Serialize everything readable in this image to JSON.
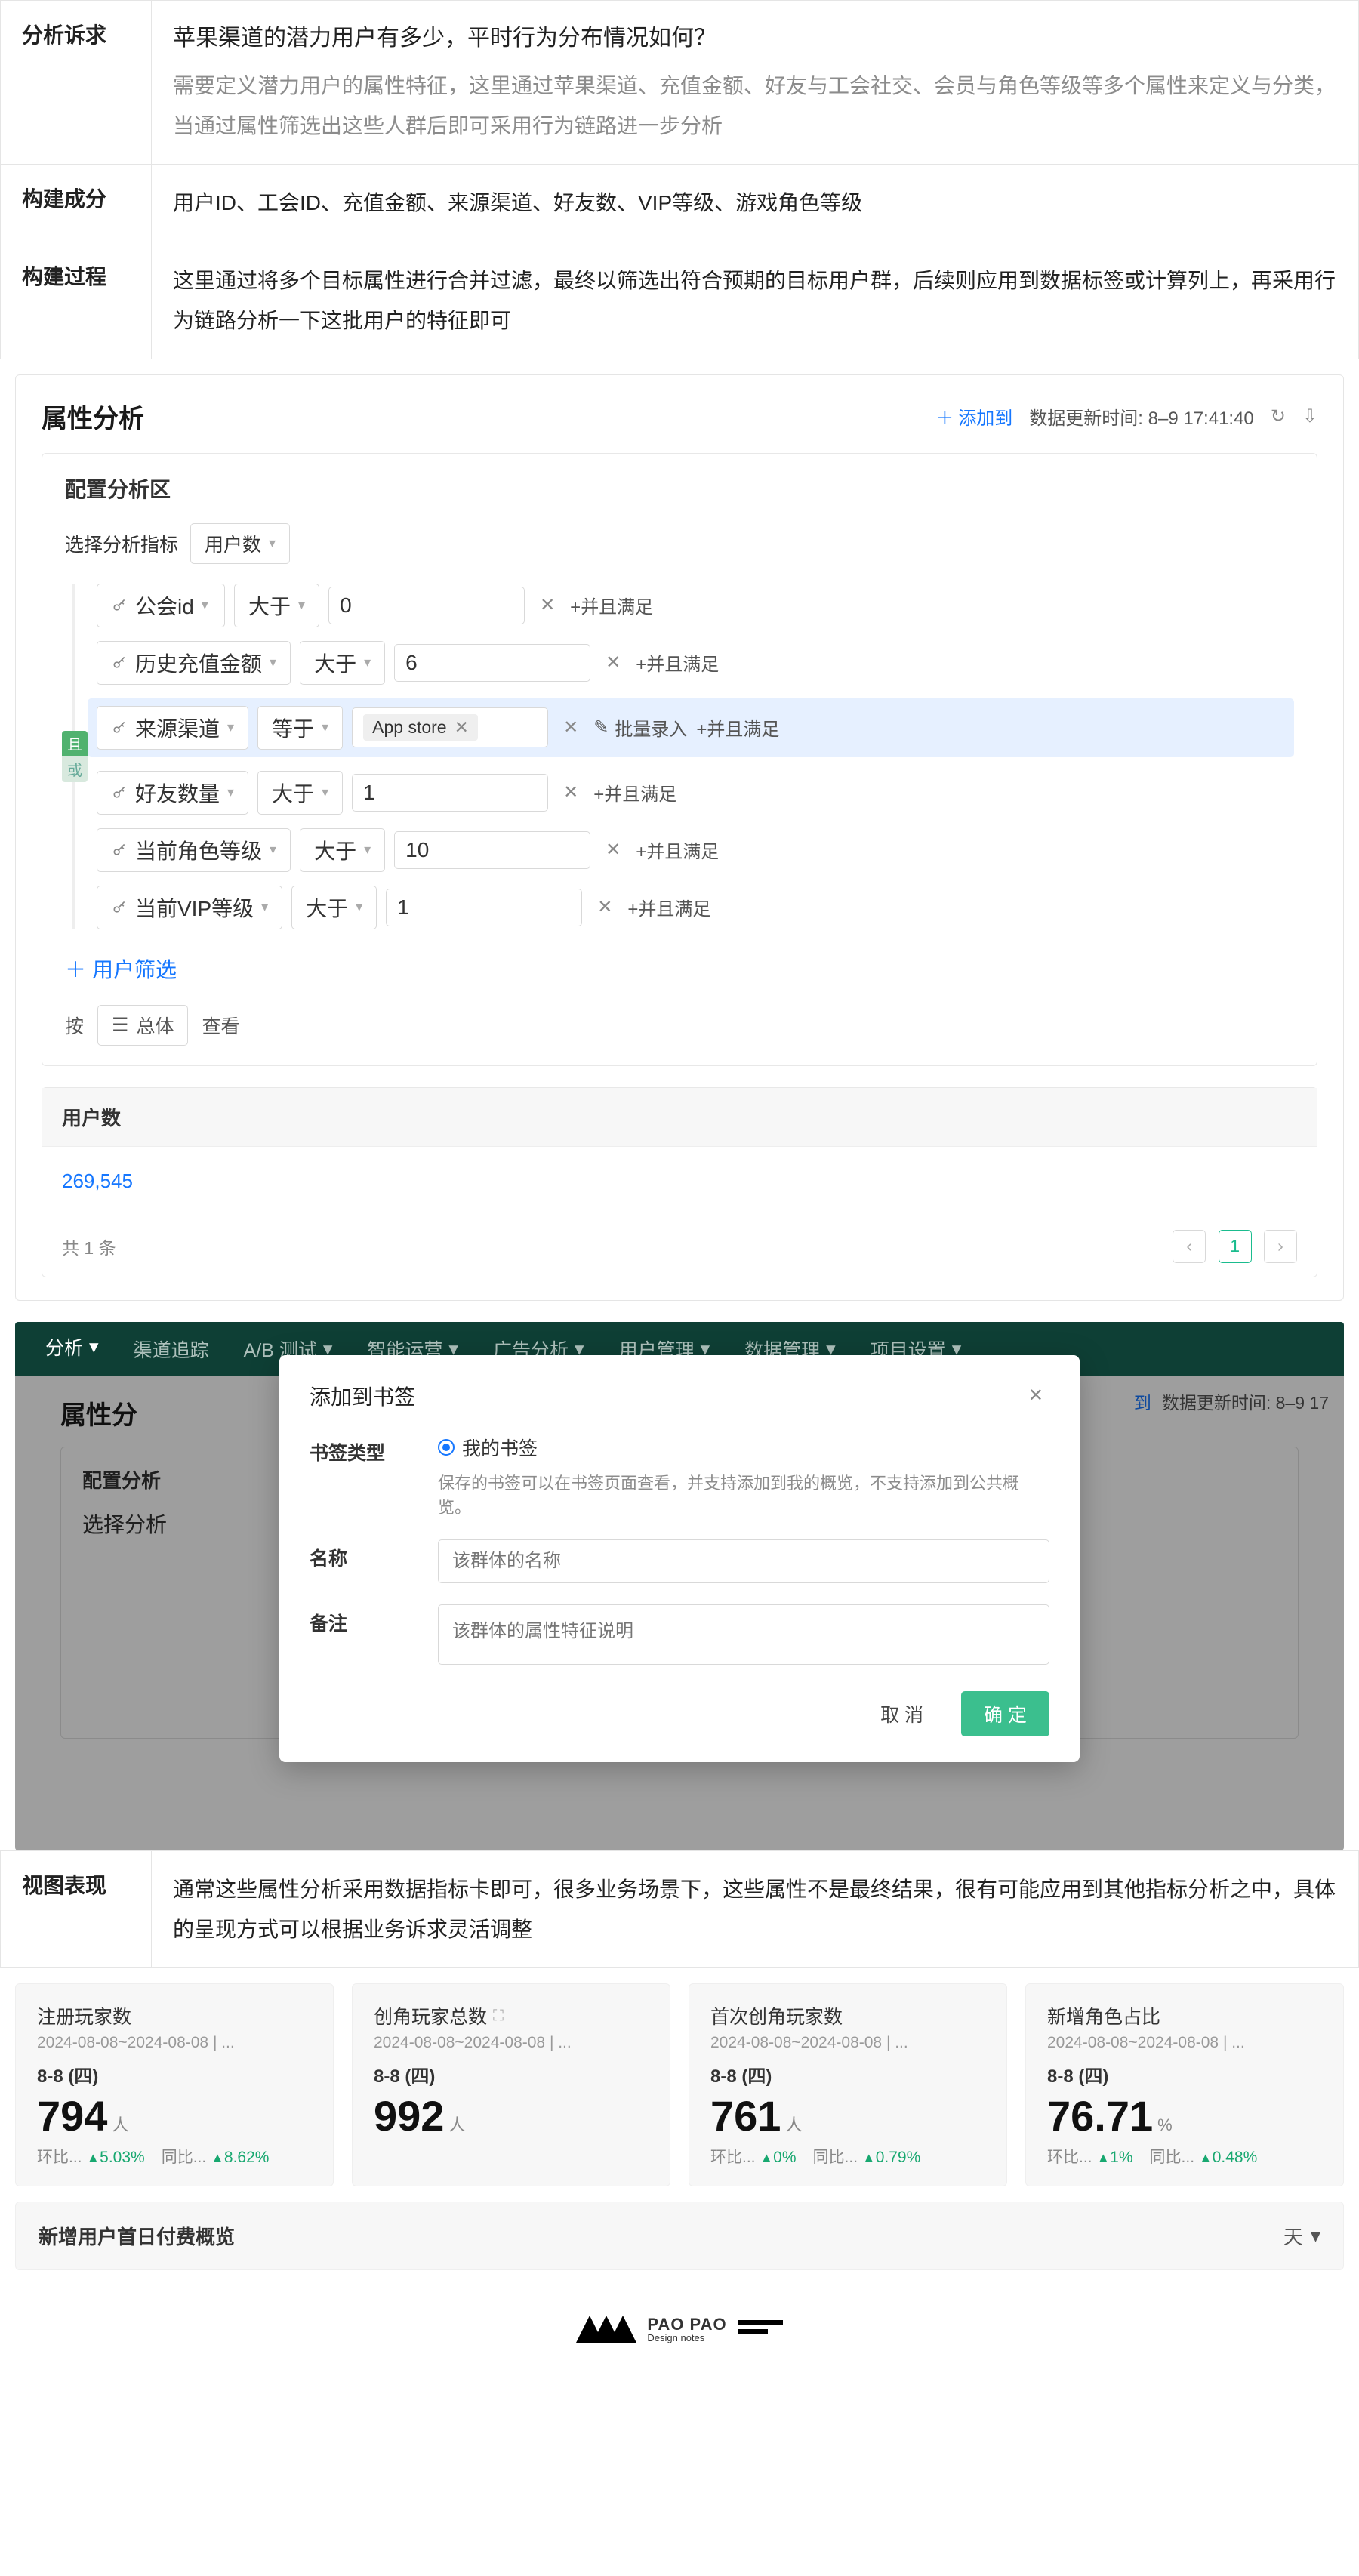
{
  "meta": {
    "rows": [
      {
        "label": "分析诉求",
        "question": "苹果渠道的潜力用户有多少，平时行为分布情况如何？",
        "desc": "需要定义潜力用户的属性特征，这里通过苹果渠道、充值金额、好友与工会社交、会员与角色等级等多个属性来定义与分类，当通过属性筛选出这些人群后即可采用行为链路进一步分析"
      },
      {
        "label": "构建成分",
        "body": "用户ID、工会ID、充值金额、来源渠道、好友数、VIP等级、游戏角色等级"
      },
      {
        "label": "构建过程",
        "body": "这里通过将多个目标属性进行合并过滤，最终以筛选出符合预期的目标用户群，后续则应用到数据标签或计算列上，再采用行为链路分析一下这批用户的特征即可"
      }
    ]
  },
  "panel": {
    "title": "属性分析",
    "add_to": "添加到",
    "update_label": "数据更新时间: 8–9 17:41:40",
    "config_title": "配置分析区",
    "metric_label": "选择分析指标",
    "metric_value": "用户数",
    "and_badge": "且",
    "or_badge": "或",
    "filters": [
      {
        "prop": "公会id",
        "op": "大于",
        "val": "0",
        "add": "+并且满足",
        "type": "text"
      },
      {
        "prop": "历史充值金额",
        "op": "大于",
        "val": "6",
        "add": "+并且满足",
        "type": "text"
      },
      {
        "prop": "来源渠道",
        "op": "等于",
        "val": "App store",
        "add": "+并且满足",
        "type": "chip",
        "hl": true,
        "bulk": "批量录入"
      },
      {
        "prop": "好友数量",
        "op": "大于",
        "val": "1",
        "add": "+并且满足",
        "type": "text"
      },
      {
        "prop": "当前角色等级",
        "op": "大于",
        "val": "10",
        "add": "+并且满足",
        "type": "text"
      },
      {
        "prop": "当前VIP等级",
        "op": "大于",
        "val": "1",
        "add": "+并且满足",
        "type": "text"
      }
    ],
    "user_filter": "用户筛选",
    "by_label": "按",
    "by_value": "总体",
    "view_label": "查看",
    "result_header": "用户数",
    "result_value": "269,545",
    "pager_total": "共 1 条",
    "pager_current": "1"
  },
  "dark": {
    "nav": [
      "分析",
      "渠道追踪",
      "A/B 测试",
      "智能运营",
      "广告分析",
      "用户管理",
      "数据管理",
      "项目设置"
    ],
    "bg_title": "属性分",
    "bg_config": "配置分析",
    "bg_metric": "选择分析",
    "bg_addto": "到",
    "bg_update": "数据更新时间: 8–9 17",
    "modal": {
      "title": "添加到书签",
      "type_label": "书签类型",
      "type_value": "我的书签",
      "type_hint": "保存的书签可以在书签页面查看，并支持添加到我的概览，不支持添加到公共概览。",
      "name_label": "名称",
      "name_ph": "该群体的名称",
      "remark_label": "备注",
      "remark_ph": "该群体的属性特征说明",
      "cancel": "取 消",
      "ok": "确 定"
    }
  },
  "view_row": {
    "label": "视图表现",
    "body": "通常这些属性分析采用数据指标卡即可，很多业务场景下，这些属性不是最终结果，很有可能应用到其他指标分析之中，具体的呈现方式可以根据业务诉求灵活调整"
  },
  "kpis": [
    {
      "title": "注册玩家数",
      "date": "2024-08-08~2024-08-08 | ...",
      "sub": "8-8 (四)",
      "val": "794",
      "unit": "人",
      "foot1_label": "环比...",
      "foot1_val": "5.03%",
      "foot2_label": "同比...",
      "foot2_val": "8.62%"
    },
    {
      "title": "创角玩家总数",
      "icon": true,
      "date": "2024-08-08~2024-08-08 | ...",
      "sub": "8-8 (四)",
      "val": "992",
      "unit": "人",
      "foot1_label": "",
      "foot1_val": "",
      "foot2_label": "",
      "foot2_val": ""
    },
    {
      "title": "首次创角玩家数",
      "date": "2024-08-08~2024-08-08 | ...",
      "sub": "8-8 (四)",
      "val": "761",
      "unit": "人",
      "foot1_label": "环比...",
      "foot1_val": "0%",
      "foot2_label": "同比...",
      "foot2_val": "0.79%"
    },
    {
      "title": "新增角色占比",
      "date": "2024-08-08~2024-08-08 | ...",
      "sub": "8-8 (四)",
      "val": "76.71",
      "unit": "%",
      "foot1_label": "环比...",
      "foot1_val": "1%",
      "foot2_label": "同比...",
      "foot2_val": "0.48%"
    }
  ],
  "wide": {
    "title": "新增用户首日付费概览",
    "sel": "天"
  },
  "logo": {
    "name": "PAO PAO",
    "sub": "Design notes"
  }
}
